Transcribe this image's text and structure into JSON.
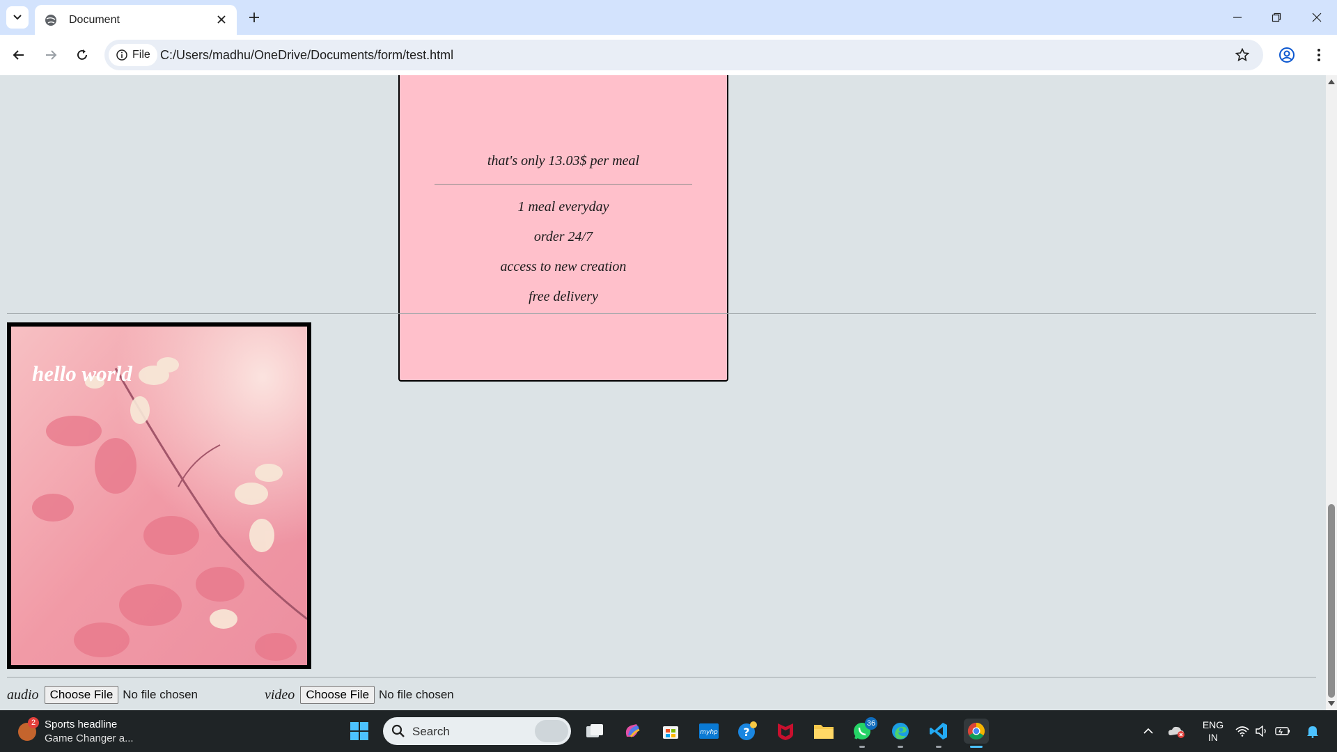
{
  "browser": {
    "tab_title": "Document",
    "site_chip": "File",
    "url": "C:/Users/madhu/OneDrive/Documents/form/test.html"
  },
  "page": {
    "pricing": {
      "price_note": "that's only 13.03$ per meal",
      "features": [
        "1 meal everyday",
        "order 24/7",
        "access to new creation",
        "free delivery"
      ]
    },
    "image_caption": "hello world",
    "uploads": [
      {
        "label": "audio",
        "button": "Choose File",
        "status": "No file chosen"
      },
      {
        "label": "video",
        "button": "Choose File",
        "status": "No file chosen"
      }
    ]
  },
  "taskbar": {
    "widget_title": "Sports headline",
    "widget_subtitle": "Game Changer a...",
    "widget_badge": "2",
    "search_placeholder": "Search",
    "whatsapp_badge": "36",
    "language_line1": "ENG",
    "language_line2": "IN"
  },
  "colors": {
    "page_background": "#dce3e6",
    "card_background": "#ffc0cb",
    "tabstrip": "#d3e3fd",
    "taskbar": "#1f2426"
  }
}
